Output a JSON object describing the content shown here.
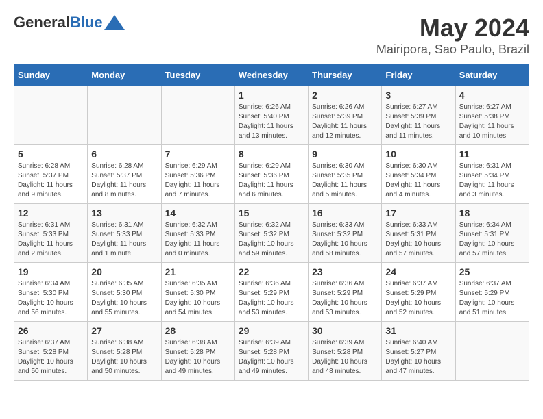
{
  "header": {
    "logo_general": "General",
    "logo_blue": "Blue",
    "month_title": "May 2024",
    "location": "Mairipora, Sao Paulo, Brazil"
  },
  "days_of_week": [
    "Sunday",
    "Monday",
    "Tuesday",
    "Wednesday",
    "Thursday",
    "Friday",
    "Saturday"
  ],
  "weeks": [
    {
      "days": [
        {
          "num": "",
          "info": ""
        },
        {
          "num": "",
          "info": ""
        },
        {
          "num": "",
          "info": ""
        },
        {
          "num": "1",
          "info": "Sunrise: 6:26 AM\nSunset: 5:40 PM\nDaylight: 11 hours\nand 13 minutes."
        },
        {
          "num": "2",
          "info": "Sunrise: 6:26 AM\nSunset: 5:39 PM\nDaylight: 11 hours\nand 12 minutes."
        },
        {
          "num": "3",
          "info": "Sunrise: 6:27 AM\nSunset: 5:39 PM\nDaylight: 11 hours\nand 11 minutes."
        },
        {
          "num": "4",
          "info": "Sunrise: 6:27 AM\nSunset: 5:38 PM\nDaylight: 11 hours\nand 10 minutes."
        }
      ]
    },
    {
      "days": [
        {
          "num": "5",
          "info": "Sunrise: 6:28 AM\nSunset: 5:37 PM\nDaylight: 11 hours\nand 9 minutes."
        },
        {
          "num": "6",
          "info": "Sunrise: 6:28 AM\nSunset: 5:37 PM\nDaylight: 11 hours\nand 8 minutes."
        },
        {
          "num": "7",
          "info": "Sunrise: 6:29 AM\nSunset: 5:36 PM\nDaylight: 11 hours\nand 7 minutes."
        },
        {
          "num": "8",
          "info": "Sunrise: 6:29 AM\nSunset: 5:36 PM\nDaylight: 11 hours\nand 6 minutes."
        },
        {
          "num": "9",
          "info": "Sunrise: 6:30 AM\nSunset: 5:35 PM\nDaylight: 11 hours\nand 5 minutes."
        },
        {
          "num": "10",
          "info": "Sunrise: 6:30 AM\nSunset: 5:34 PM\nDaylight: 11 hours\nand 4 minutes."
        },
        {
          "num": "11",
          "info": "Sunrise: 6:31 AM\nSunset: 5:34 PM\nDaylight: 11 hours\nand 3 minutes."
        }
      ]
    },
    {
      "days": [
        {
          "num": "12",
          "info": "Sunrise: 6:31 AM\nSunset: 5:33 PM\nDaylight: 11 hours\nand 2 minutes."
        },
        {
          "num": "13",
          "info": "Sunrise: 6:31 AM\nSunset: 5:33 PM\nDaylight: 11 hours\nand 1 minute."
        },
        {
          "num": "14",
          "info": "Sunrise: 6:32 AM\nSunset: 5:33 PM\nDaylight: 11 hours\nand 0 minutes."
        },
        {
          "num": "15",
          "info": "Sunrise: 6:32 AM\nSunset: 5:32 PM\nDaylight: 10 hours\nand 59 minutes."
        },
        {
          "num": "16",
          "info": "Sunrise: 6:33 AM\nSunset: 5:32 PM\nDaylight: 10 hours\nand 58 minutes."
        },
        {
          "num": "17",
          "info": "Sunrise: 6:33 AM\nSunset: 5:31 PM\nDaylight: 10 hours\nand 57 minutes."
        },
        {
          "num": "18",
          "info": "Sunrise: 6:34 AM\nSunset: 5:31 PM\nDaylight: 10 hours\nand 57 minutes."
        }
      ]
    },
    {
      "days": [
        {
          "num": "19",
          "info": "Sunrise: 6:34 AM\nSunset: 5:30 PM\nDaylight: 10 hours\nand 56 minutes."
        },
        {
          "num": "20",
          "info": "Sunrise: 6:35 AM\nSunset: 5:30 PM\nDaylight: 10 hours\nand 55 minutes."
        },
        {
          "num": "21",
          "info": "Sunrise: 6:35 AM\nSunset: 5:30 PM\nDaylight: 10 hours\nand 54 minutes."
        },
        {
          "num": "22",
          "info": "Sunrise: 6:36 AM\nSunset: 5:29 PM\nDaylight: 10 hours\nand 53 minutes."
        },
        {
          "num": "23",
          "info": "Sunrise: 6:36 AM\nSunset: 5:29 PM\nDaylight: 10 hours\nand 53 minutes."
        },
        {
          "num": "24",
          "info": "Sunrise: 6:37 AM\nSunset: 5:29 PM\nDaylight: 10 hours\nand 52 minutes."
        },
        {
          "num": "25",
          "info": "Sunrise: 6:37 AM\nSunset: 5:29 PM\nDaylight: 10 hours\nand 51 minutes."
        }
      ]
    },
    {
      "days": [
        {
          "num": "26",
          "info": "Sunrise: 6:37 AM\nSunset: 5:28 PM\nDaylight: 10 hours\nand 50 minutes."
        },
        {
          "num": "27",
          "info": "Sunrise: 6:38 AM\nSunset: 5:28 PM\nDaylight: 10 hours\nand 50 minutes."
        },
        {
          "num": "28",
          "info": "Sunrise: 6:38 AM\nSunset: 5:28 PM\nDaylight: 10 hours\nand 49 minutes."
        },
        {
          "num": "29",
          "info": "Sunrise: 6:39 AM\nSunset: 5:28 PM\nDaylight: 10 hours\nand 49 minutes."
        },
        {
          "num": "30",
          "info": "Sunrise: 6:39 AM\nSunset: 5:28 PM\nDaylight: 10 hours\nand 48 minutes."
        },
        {
          "num": "31",
          "info": "Sunrise: 6:40 AM\nSunset: 5:27 PM\nDaylight: 10 hours\nand 47 minutes."
        },
        {
          "num": "",
          "info": ""
        }
      ]
    }
  ]
}
